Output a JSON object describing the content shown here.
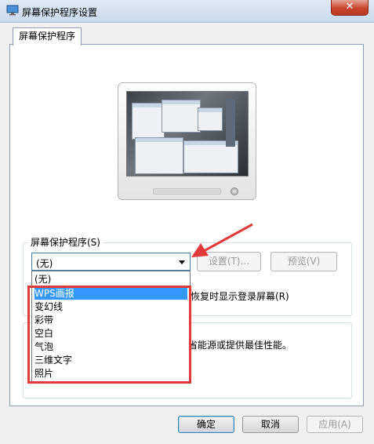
{
  "window": {
    "title": "屏幕保护程序设置",
    "close_label": "✕",
    "app_icon": "display-settings-icon"
  },
  "tab": {
    "label": "屏幕保护程序"
  },
  "screensaver": {
    "group_label": "屏幕保护程序(S)",
    "selected": "(无)",
    "settings_button": "设置(T)...",
    "preview_button": "预览(V)",
    "resume_text": "恢复时显示登录屏幕(R)",
    "options": [
      "(无)",
      "WPS画报",
      "变幻线",
      "彩带",
      "空白",
      "气泡",
      "三维文字",
      "照片"
    ],
    "highlighted_option": "WPS画报"
  },
  "power": {
    "text": "省能源或提供最佳性能。"
  },
  "footer": {
    "ok": "确定",
    "cancel": "取消",
    "apply": "应用(A)"
  },
  "annotation": {
    "highlight_color": "#e03a3a"
  }
}
